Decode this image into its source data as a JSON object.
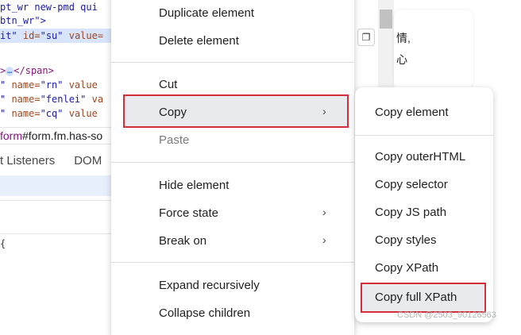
{
  "devtools": {
    "code_lines": [
      {
        "parts": [
          {
            "t": "pt_wr new-pmd qui",
            "c": "tok-val"
          }
        ]
      },
      {
        "parts": [
          {
            "t": "btn_wr\">",
            "c": "tok-val"
          }
        ]
      },
      {
        "parts": [
          {
            "t": "it\" ",
            "c": "tok-val"
          },
          {
            "t": "id=",
            "c": "tok-attr"
          },
          {
            "t": "\"su\" ",
            "c": "tok-val"
          },
          {
            "t": "value=",
            "c": "tok-attr"
          }
        ]
      },
      {
        "parts": []
      },
      {
        "parts": [
          {
            "t": ">",
            "c": "tok-tag"
          },
          {
            "t": "…",
            "c": "ellipsis"
          },
          {
            "t": "</span>",
            "c": "tok-tag"
          }
        ]
      },
      {
        "parts": [
          {
            "t": "\" ",
            "c": "tok-val"
          },
          {
            "t": "name=",
            "c": "tok-attr"
          },
          {
            "t": "\"rn\" ",
            "c": "tok-val"
          },
          {
            "t": "value",
            "c": "tok-attr"
          }
        ]
      },
      {
        "parts": [
          {
            "t": "\" ",
            "c": "tok-val"
          },
          {
            "t": "name=",
            "c": "tok-attr"
          },
          {
            "t": "\"fenlei\" ",
            "c": "tok-val"
          },
          {
            "t": "va",
            "c": "tok-attr"
          }
        ]
      },
      {
        "parts": [
          {
            "t": "\" ",
            "c": "tok-val"
          },
          {
            "t": "name=",
            "c": "tok-attr"
          },
          {
            "t": "\"cq\" ",
            "c": "tok-val"
          },
          {
            "t": "value",
            "c": "tok-attr"
          }
        ]
      }
    ],
    "breadcrumb_tag": "form",
    "breadcrumb_rest": "#form.fm.has-so",
    "tabs": [
      "t Listeners",
      "DOM"
    ],
    "brace": "{"
  },
  "page": {
    "text_line_1": "情,",
    "text_line_2": "心",
    "hover_icon_glyph": "❐"
  },
  "main_menu": {
    "items": [
      {
        "label": "Duplicate element"
      },
      {
        "label": "Delete element"
      },
      {
        "label": "Cut"
      },
      {
        "label": "Copy",
        "submenu": true
      },
      {
        "label": "Paste",
        "disabled": true
      },
      {
        "label": "Hide element"
      },
      {
        "label": "Force state",
        "submenu": true
      },
      {
        "label": "Break on",
        "submenu": true
      },
      {
        "label": "Expand recursively"
      },
      {
        "label": "Collapse children"
      }
    ],
    "chevron": "›"
  },
  "sub_menu": {
    "items": [
      {
        "label": "Copy element"
      },
      {
        "label": "Copy outerHTML"
      },
      {
        "label": "Copy selector"
      },
      {
        "label": "Copy JS path"
      },
      {
        "label": "Copy styles"
      },
      {
        "label": "Copy XPath"
      },
      {
        "label": "Copy full XPath"
      }
    ]
  },
  "colors": {
    "highlight_border": "#d32f3a",
    "hover_bg": "#e8eaed",
    "selection_bg": "#d8e4fb"
  },
  "watermark": "CSDN @2503_90126563"
}
